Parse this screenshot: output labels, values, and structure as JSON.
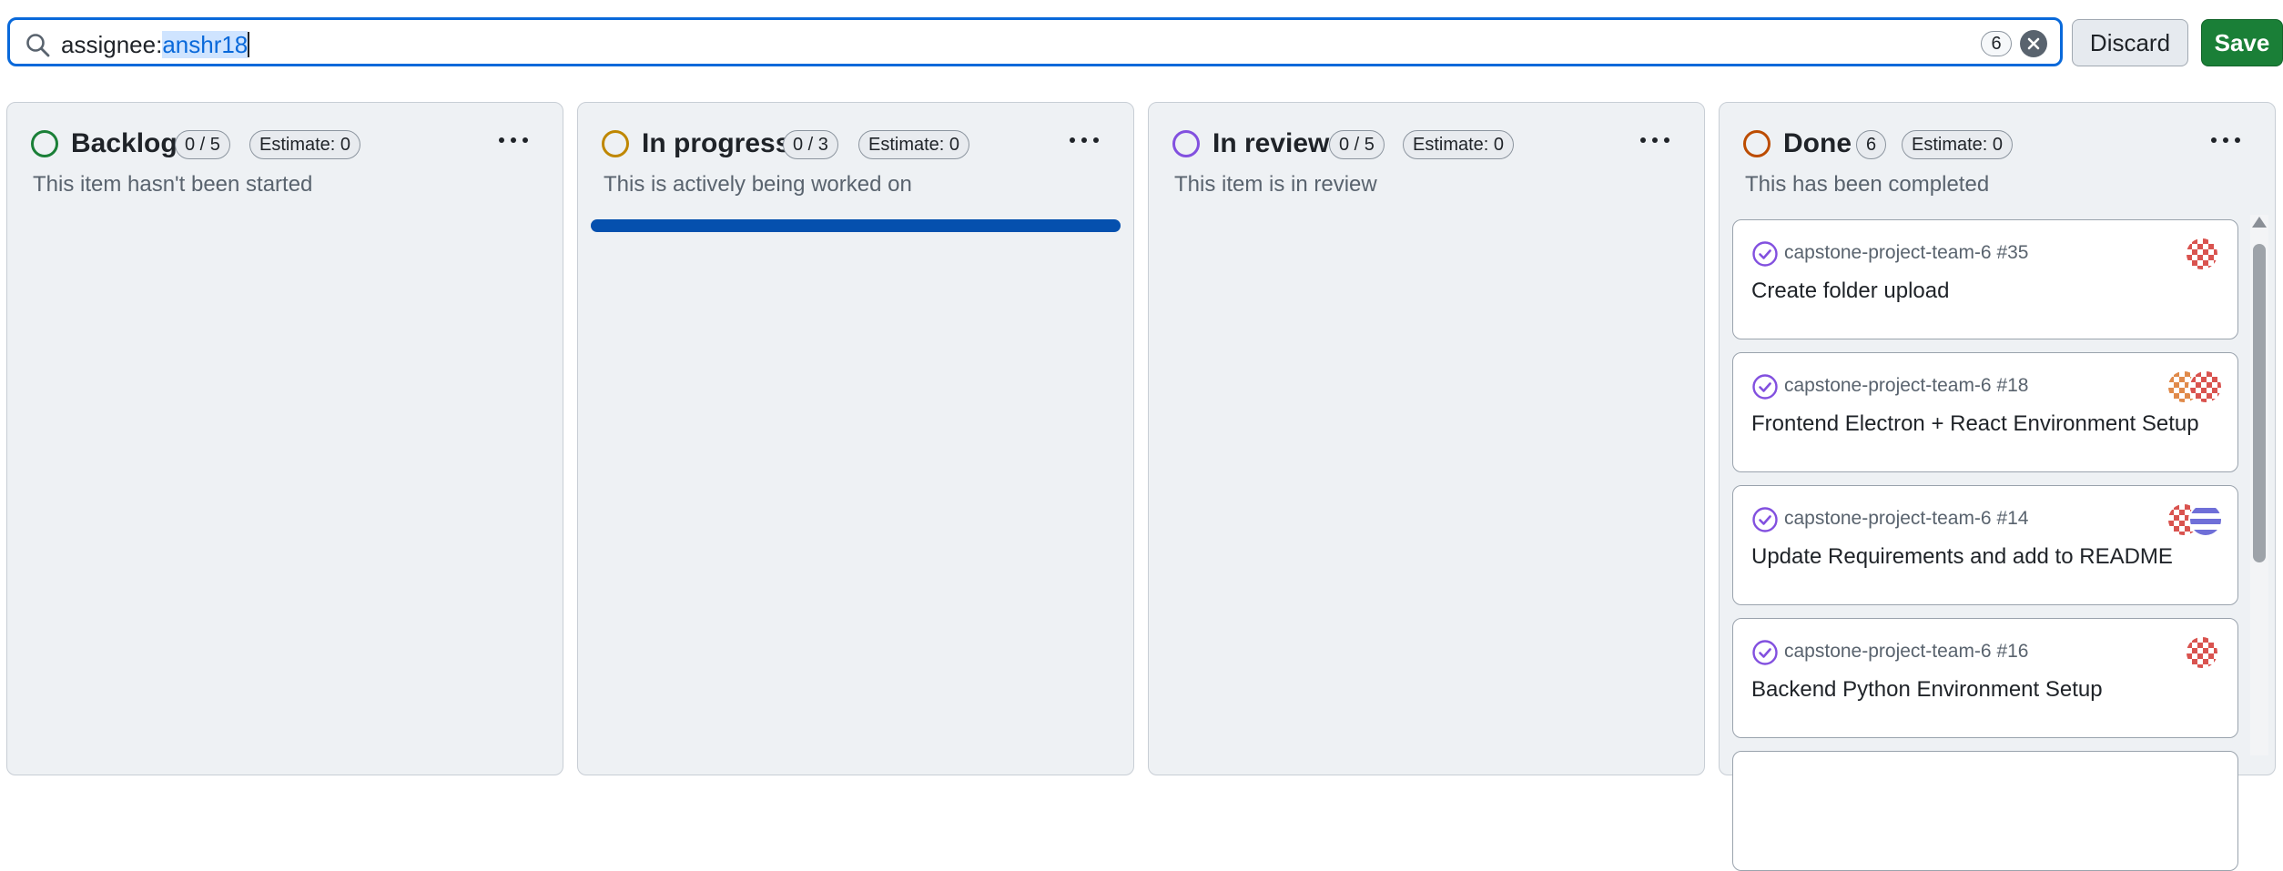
{
  "filter": {
    "query_key": "assignee:",
    "query_value": "anshr18",
    "result_count": "6",
    "discard_label": "Discard",
    "save_label": "Save"
  },
  "colors": {
    "accent": "#0969da",
    "save_green": "#1a7f37",
    "backlog": "#1a7f37",
    "in_progress": "#bf8700",
    "in_review": "#8250df",
    "done": "#bc4c00",
    "done_check": "#8250df",
    "progress_bar": "#0550ae"
  },
  "columns": [
    {
      "title": "Backlog",
      "count": "0 / 5",
      "estimate": "Estimate: 0",
      "description": "This item hasn't been started",
      "cards": []
    },
    {
      "title": "In progress",
      "count": "0 / 3",
      "estimate": "Estimate: 0",
      "description": "This is actively being worked on",
      "loading": true,
      "cards": []
    },
    {
      "title": "In review",
      "count": "0 / 5",
      "estimate": "Estimate: 0",
      "description": "This item is in review",
      "cards": []
    },
    {
      "title": "Done",
      "count": "6",
      "estimate": "Estimate: 0",
      "description": "This has been completed",
      "cards": [
        {
          "repo": "capstone-project-team-6 #35",
          "title": "Create folder upload",
          "icon": "check-circle-icon",
          "avatars": [
            "red"
          ]
        },
        {
          "repo": "capstone-project-team-6 #18",
          "title": "Frontend Electron + React Environment Setup",
          "icon": "check-circle-icon",
          "avatars": [
            "orange",
            "red"
          ]
        },
        {
          "repo": "capstone-project-team-6 #14",
          "title": "Update Requirements and add to README",
          "icon": "check-circle-icon",
          "avatars": [
            "red",
            "purple"
          ]
        },
        {
          "repo": "capstone-project-team-6 #16",
          "title": "Backend Python Environment Setup",
          "icon": "check-circle-icon",
          "avatars": [
            "red"
          ]
        }
      ]
    }
  ]
}
